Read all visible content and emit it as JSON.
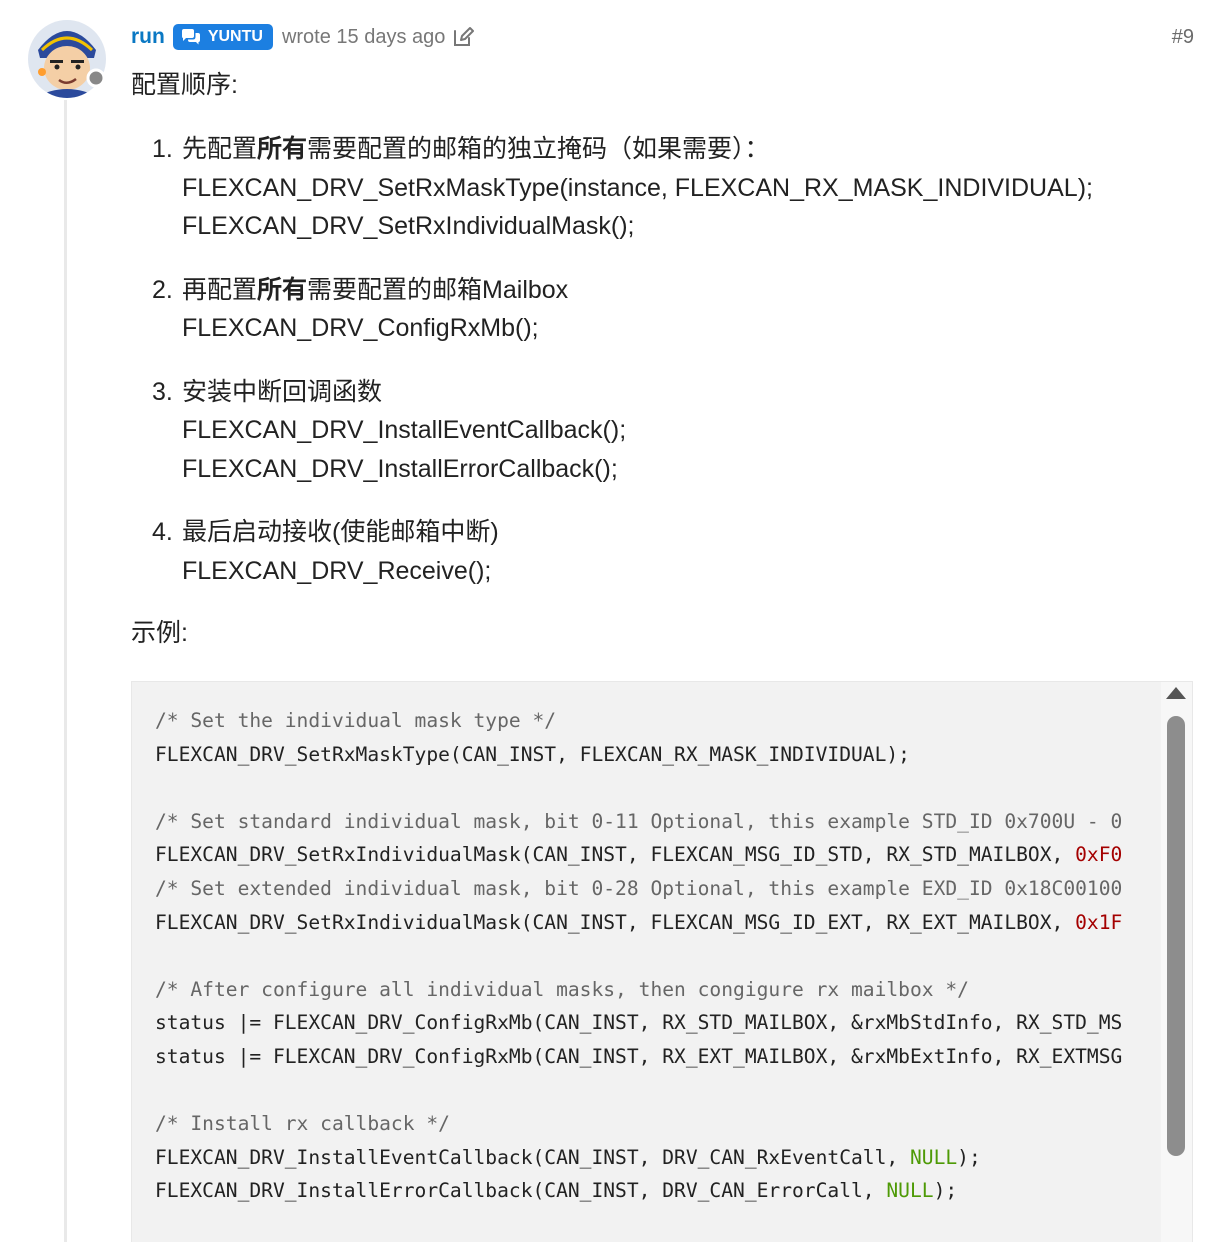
{
  "post": {
    "username": "run",
    "group_badge": "YUNTU",
    "meta": "wrote 15 days ago",
    "post_number": "#9",
    "intro": "配置顺序:",
    "steps": [
      {
        "number": "1.",
        "title_pre": "先配置",
        "title_bold": "所有",
        "title_post": "需要配置的邮箱的独立掩码（如果需要）：",
        "code_lines": [
          "FLEXCAN_DRV_SetRxMaskType(instance, FLEXCAN_RX_MASK_INDIVIDUAL);",
          "FLEXCAN_DRV_SetRxIndividualMask();"
        ]
      },
      {
        "number": "2.",
        "title_pre": "再配置",
        "title_bold": "所有",
        "title_post": "需要配置的邮箱Mailbox",
        "code_lines": [
          "FLEXCAN_DRV_ConfigRxMb();"
        ]
      },
      {
        "number": "3.",
        "title_pre": "安装中断回调函数",
        "title_bold": "",
        "title_post": "",
        "code_lines": [
          "FLEXCAN_DRV_InstallEventCallback();",
          "FLEXCAN_DRV_InstallErrorCallback();"
        ]
      },
      {
        "number": "4.",
        "title_pre": "最后启动接收(使能邮箱中断)",
        "title_bold": "",
        "title_post": "",
        "code_lines": [
          "FLEXCAN_DRV_Receive();"
        ]
      }
    ],
    "example_label": "示例:"
  },
  "code": {
    "lines": [
      {
        "type": "comment",
        "text": "/* Set the individual mask type */"
      },
      {
        "type": "code",
        "text": "FLEXCAN_DRV_SetRxMaskType(CAN_INST, FLEXCAN_RX_MASK_INDIVIDUAL);"
      },
      {
        "type": "blank",
        "text": ""
      },
      {
        "type": "comment",
        "text": "/* Set standard individual mask, bit 0-11 Optional, this example STD_ID 0x700U - 0"
      },
      {
        "type": "code",
        "text": "FLEXCAN_DRV_SetRxIndividualMask(CAN_INST, FLEXCAN_MSG_ID_STD, RX_STD_MAILBOX, ",
        "accent": "0xF0",
        "accent_class": "hex"
      },
      {
        "type": "comment",
        "text": "/* Set extended individual mask, bit 0-28 Optional, this example EXD_ID 0x18C00100"
      },
      {
        "type": "code",
        "text": "FLEXCAN_DRV_SetRxIndividualMask(CAN_INST, FLEXCAN_MSG_ID_EXT, RX_EXT_MAILBOX, ",
        "accent": "0x1F",
        "accent_class": "hex"
      },
      {
        "type": "blank",
        "text": ""
      },
      {
        "type": "comment",
        "text": "/* After configure all individual masks, then congigure rx mailbox */"
      },
      {
        "type": "code",
        "text": "status |= FLEXCAN_DRV_ConfigRxMb(CAN_INST, RX_STD_MAILBOX, &rxMbStdInfo, RX_STD_MS"
      },
      {
        "type": "code",
        "text": "status |= FLEXCAN_DRV_ConfigRxMb(CAN_INST, RX_EXT_MAILBOX, &rxMbExtInfo, RX_EXTMSG"
      },
      {
        "type": "blank",
        "text": ""
      },
      {
        "type": "comment",
        "text": "/* Install rx callback */"
      },
      {
        "type": "code",
        "text": "FLEXCAN_DRV_InstallEventCallback(CAN_INST, DRV_CAN_RxEventCall, ",
        "accent": "NULL",
        "accent_class": "kw",
        "tail": ");"
      },
      {
        "type": "code",
        "text": "FLEXCAN_DRV_InstallErrorCallback(CAN_INST, DRV_CAN_ErrorCall, ",
        "accent": "NULL",
        "accent_class": "kw",
        "tail": ");"
      }
    ]
  },
  "colors": {
    "username": "#0a78c3",
    "badge": "#1c7fe1",
    "code_background": "#f2f2f2",
    "keyword": "#4e9a06",
    "hex_literal": "#a40000"
  }
}
